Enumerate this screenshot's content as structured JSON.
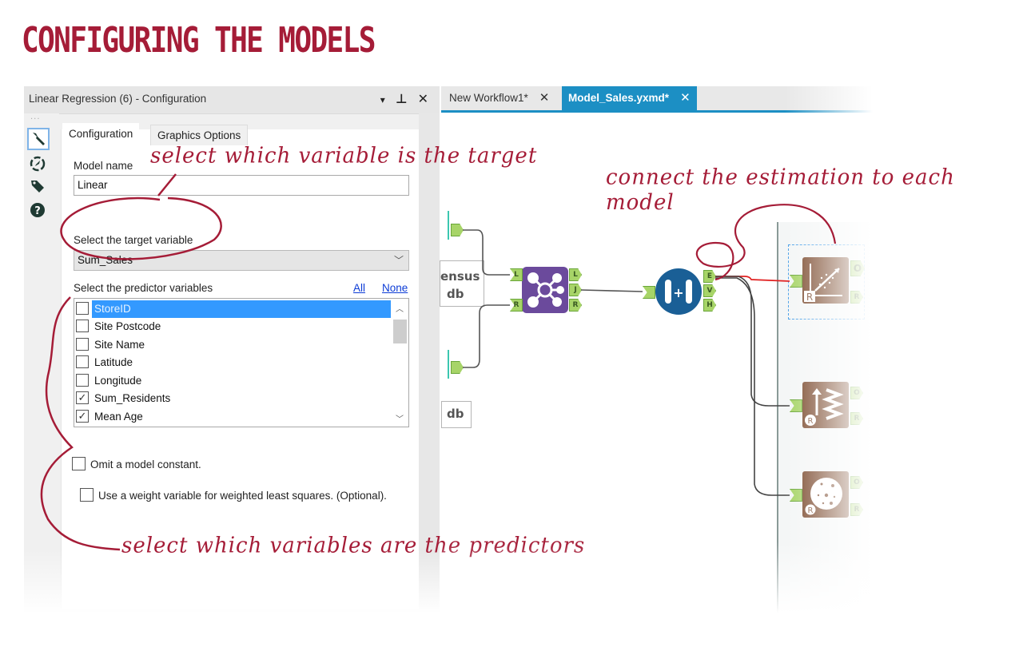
{
  "page": {
    "title": "CONFIGURING THE MODELS"
  },
  "config_panel": {
    "title": "Linear Regression (6) - Configuration",
    "header_controls": {
      "dropdown": "▾",
      "pin": "📌",
      "close": "✕"
    },
    "side_toolbar": [
      {
        "name": "configuration",
        "icon": "wrench-icon",
        "glyph": "🔧"
      },
      {
        "name": "annotation",
        "icon": "compass-icon",
        "glyph": "◈"
      },
      {
        "name": "meta-info",
        "icon": "tag-icon",
        "glyph": "🏷"
      },
      {
        "name": "help",
        "icon": "help-icon",
        "glyph": "?"
      }
    ],
    "tabs": [
      {
        "label": "Configuration",
        "active": true
      },
      {
        "label": "Graphics Options",
        "active": false
      }
    ],
    "model_name_label": "Model name",
    "model_name_value": "Linear",
    "target_label": "Select the target variable",
    "target_value": "Sum_Sales",
    "predictor_label": "Select the predictor variables",
    "all_link": "All",
    "none_link": "None",
    "predictors": [
      {
        "label": "StoreID",
        "checked": false,
        "selected": true
      },
      {
        "label": "Site Postcode",
        "checked": false,
        "selected": false
      },
      {
        "label": "Site Name",
        "checked": false,
        "selected": false
      },
      {
        "label": "Latitude",
        "checked": false,
        "selected": false
      },
      {
        "label": "Longitude",
        "checked": false,
        "selected": false
      },
      {
        "label": "Sum_Residents",
        "checked": true,
        "selected": false
      },
      {
        "label": "Mean Age",
        "checked": true,
        "selected": false
      }
    ],
    "omit_constant": {
      "label": "Omit a model constant.",
      "checked": false
    },
    "weight_variable": {
      "label": "Use a weight variable for weighted least squares. (Optional).",
      "checked": false
    }
  },
  "workflow": {
    "tabs": [
      {
        "label": "New Workflow1*",
        "active": false,
        "close": "✕"
      },
      {
        "label": "Model_Sales.yxmd*",
        "active": true,
        "close": "✕"
      }
    ],
    "doc_boxes": [
      {
        "text1": "ensus",
        "text2": "db"
      },
      {
        "text1": "db"
      }
    ],
    "join_tool": {
      "inputs": [
        "L",
        "R"
      ],
      "outputs": [
        "L",
        "J",
        "R"
      ]
    },
    "create_samples_tool": {
      "outputs": [
        "E",
        "V",
        "H"
      ]
    },
    "models": [
      {
        "name": "linear-regression",
        "outputs": [
          "O",
          "R"
        ]
      },
      {
        "name": "boosted-model",
        "outputs": [
          "O",
          "R"
        ]
      },
      {
        "name": "forest-model",
        "outputs": [
          "O",
          "R"
        ]
      }
    ],
    "colors": {
      "tab_active": "#1c8fc4",
      "join": "#6b4a9c",
      "samples": "#1a5f96",
      "model": "#7b4a2e",
      "anchor": "#a7d468",
      "connection_highlight": "#e02020"
    }
  },
  "annotations": {
    "target_note": "select which variable is the target",
    "estimation_note": "connect the estimation to each model",
    "predictors_note": "select which variables are the predictors",
    "color": "#a51c37"
  }
}
